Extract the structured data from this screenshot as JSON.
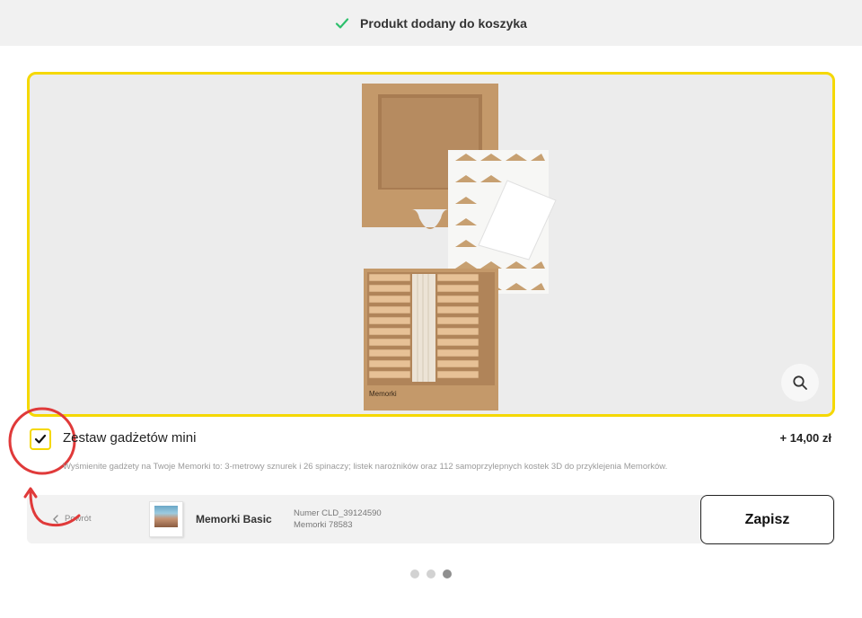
{
  "toast": {
    "message": "Produkt dodany do koszyka",
    "icon": "check-icon",
    "color": "#2dbf6c"
  },
  "option": {
    "checked": true,
    "name": "Zestaw gadżetów mini",
    "price": "+ 14,00 zł",
    "description": "Wyśmienite gadżety na Twoje Memorki to: 3-metrowy sznurek i 26 spinaczy; listek narożników oraz 112 samoprzylepnych kostek 3D do przyklejenia Memorków."
  },
  "product_image": {
    "box_label": "Memorki",
    "zoom_icon": "search-icon"
  },
  "bottom_bar": {
    "back_label": "Powrót",
    "product_name": "Memorki Basic",
    "order_number": "Numer CLD_39124590",
    "order_sub": "Memorki 78583",
    "save_label": "Zapisz"
  },
  "pager": {
    "total": 3,
    "active": 3
  },
  "colors": {
    "accent": "#f5d800",
    "highlight": "#e03a3a",
    "background": "#ececec"
  }
}
